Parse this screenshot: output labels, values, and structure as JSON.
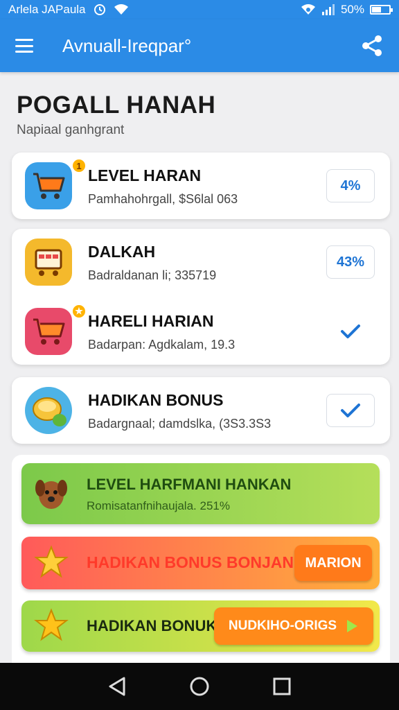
{
  "status_bar": {
    "left_text": "Arlela JAPaula",
    "battery": "50%",
    "battery_level": 0.5
  },
  "app_bar": {
    "title": "Avnuall-Ireqpar°",
    "menu_icon": "menu-icon",
    "share_icon": "share-icon"
  },
  "page": {
    "title": "POGALL HANAH",
    "subtitle": "Napiaal ganhgrant"
  },
  "group1": {
    "items": [
      {
        "name": "LEVEL HARAN",
        "desc": "Pamhahohrgall, $S6lal 063",
        "value": "4%",
        "badge": "1",
        "icon": "shopping-cart-icon",
        "icon_color": "#3aa0e8"
      }
    ]
  },
  "group2": {
    "items": [
      {
        "name": "DALKAH",
        "desc": "Badraldanan li; 335719",
        "value": "43%",
        "icon": "shop-cart-icon",
        "icon_color": "#f4b92c"
      },
      {
        "name": "HARELI HARIAN",
        "desc": "Badarpan: Agdkalam, 19.3",
        "status": "checked",
        "icon": "cart-star-icon",
        "icon_color": "#e84a6a"
      }
    ]
  },
  "group3": {
    "items": [
      {
        "name": "HADIKAN BONUS",
        "desc": "Badargnaal; damdslka, (3S3.3S3",
        "status": "checked",
        "icon": "fruit-icon",
        "icon_color": "#4db3e6"
      }
    ]
  },
  "banners": [
    {
      "title": "LEVEL HARFMANI HANKAN",
      "subtitle": "Romisatanfnihaujala. 251%",
      "icon": "dog-icon",
      "colors": [
        "#7cc94a",
        "#b5df5a"
      ]
    },
    {
      "title": "HADIKAN BONUS BONJAN",
      "button": "MARION",
      "icon": "star-badge-icon",
      "colors": [
        "#ff5a5a",
        "#ffb03b"
      ]
    },
    {
      "title": "HADIKAN BONUK",
      "button": "NUDKIHO-ORIGS",
      "icon": "star-icon",
      "colors": [
        "#9ed84a",
        "#f2e84a"
      ]
    }
  ],
  "nav": {
    "back": "back-icon",
    "home": "home-icon",
    "recents": "recents-icon"
  },
  "colors": {
    "primary": "#2b8be6",
    "accent_blue": "#1e74d4",
    "background": "#efeff1"
  }
}
